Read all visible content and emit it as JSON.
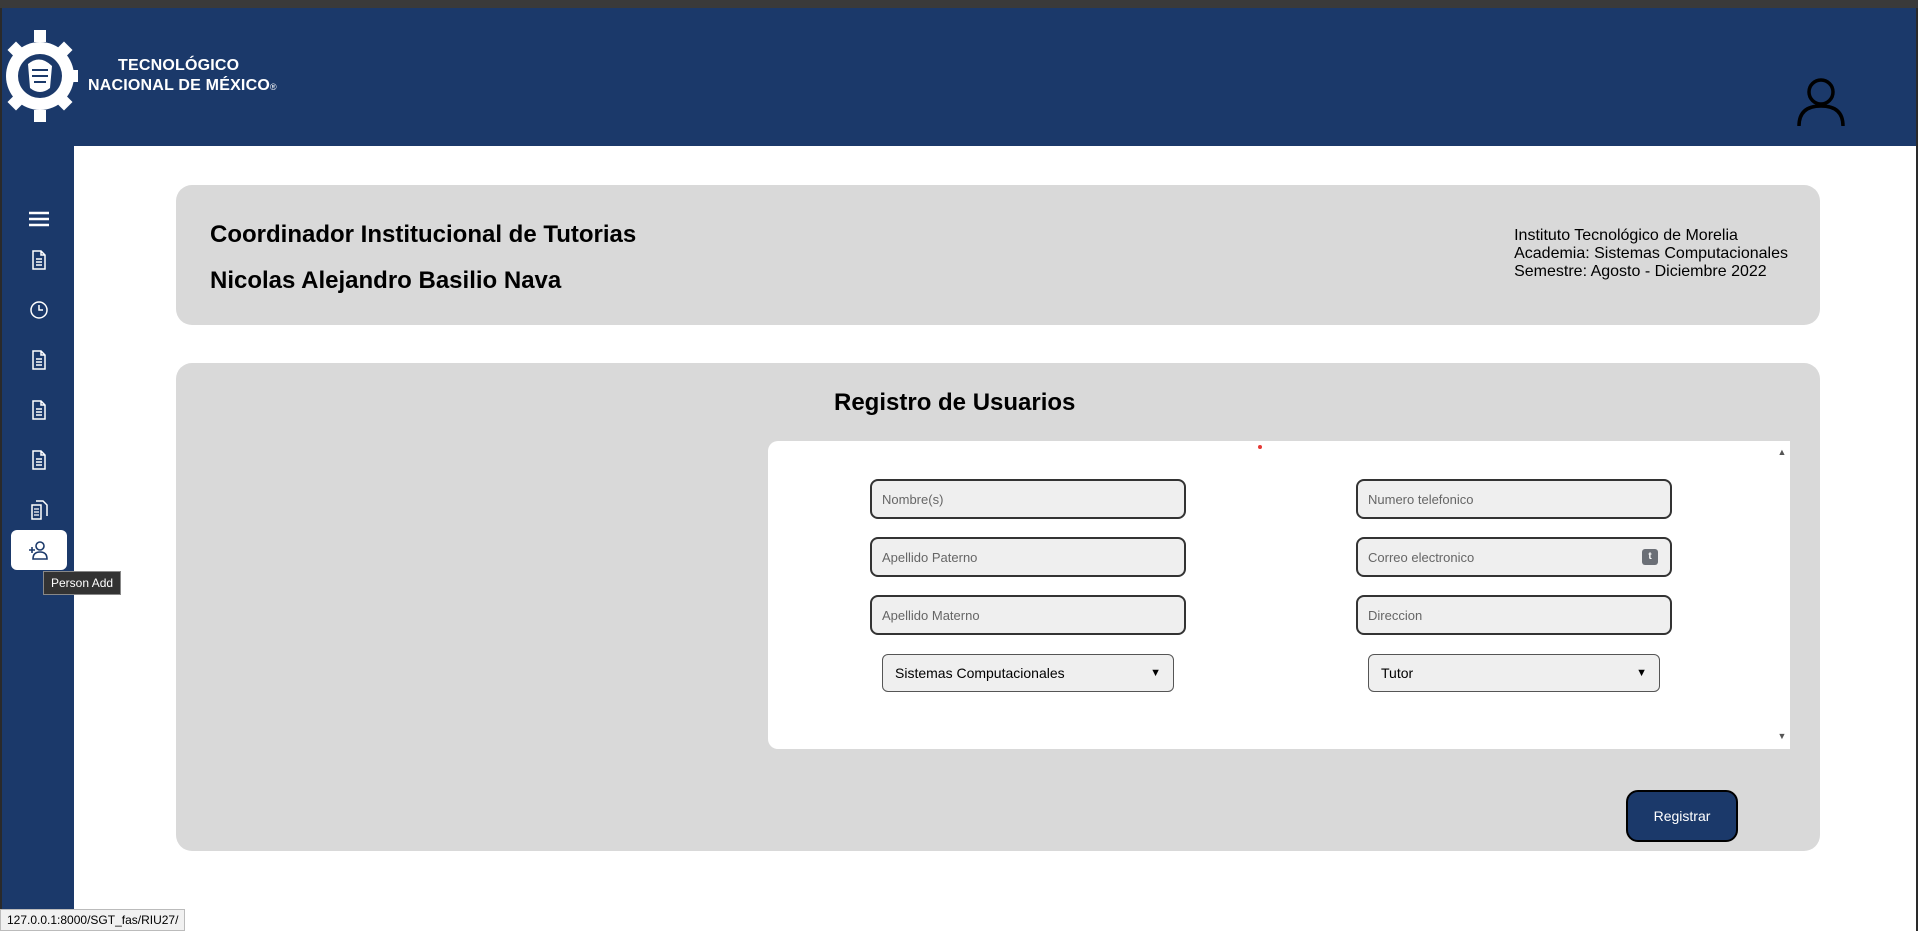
{
  "brand": {
    "line1": "TECNOLÓGICO",
    "line2": "NACIONAL DE MÉXICO",
    "registered": "®"
  },
  "colors": {
    "primary": "#1b396a",
    "card": "#d9d9d9",
    "white": "#ffffff"
  },
  "sidebar": {
    "items": [
      {
        "icon": "hamburger-menu-icon"
      },
      {
        "icon": "document-icon"
      },
      {
        "icon": "clock-icon"
      },
      {
        "icon": "document-icon"
      },
      {
        "icon": "document-icon"
      },
      {
        "icon": "document-icon"
      },
      {
        "icon": "documents-copy-icon"
      },
      {
        "icon": "person-add-icon",
        "active": true
      }
    ],
    "tooltip": "Person Add"
  },
  "header": {
    "role": "Coordinador Institucional de Tutorias",
    "name": "Nicolas Alejandro Basilio Nava",
    "institute": "Instituto Tecnológico de Morelia",
    "academy": "Academia: Sistemas Computacionales",
    "semester": "Semestre: Agosto - Diciembre 2022"
  },
  "form": {
    "title": "Registro de Usuarios",
    "nombre_placeholder": "Nombre(s)",
    "apellido_paterno_placeholder": "Apellido Paterno",
    "apellido_materno_placeholder": "Apellido Materno",
    "telefono_placeholder": "Numero telefonico",
    "correo_placeholder": "Correo electronico",
    "direccion_placeholder": "Direccion",
    "academia_selected": "Sistemas Computacionales",
    "rol_selected": "Tutor",
    "submit_label": "Registrar",
    "email_badge": "t"
  },
  "status_url": "127.0.0.1:8000/SGT_fas/RIU27/"
}
